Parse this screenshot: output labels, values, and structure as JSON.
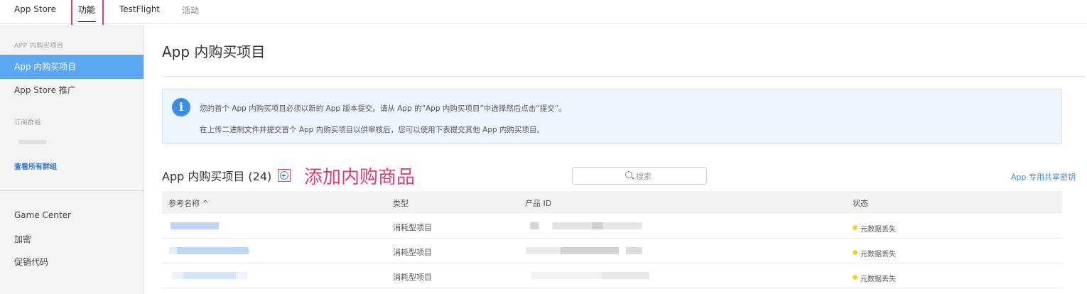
{
  "topnav": {
    "tabs": [
      {
        "label": "App Store"
      },
      {
        "label": "功能"
      },
      {
        "label": "TestFlight"
      },
      {
        "label": "活动"
      }
    ]
  },
  "sidebar": {
    "section1": "APP 内购买项目",
    "items": [
      {
        "label": "App 内购买项目",
        "active": true
      },
      {
        "label": "App Store 推广",
        "active": false
      }
    ],
    "section2": "订阅群组",
    "view_all": "查看所有群组",
    "bottom_items": [
      {
        "label": "Game Center"
      },
      {
        "label": "加密"
      },
      {
        "label": "促销代码"
      }
    ]
  },
  "main": {
    "title": "App 内购买项目",
    "info": {
      "line1": "您的首个 App 内购买项目必须以新的 App 版本提交。请从 App 的“App 内购买项目”中选择然后点击“提交”。",
      "line2": "在上传二进制文件并提交首个 App 内购买项目以供审核后，您可以使用下表提交其他 App 内购买项目。"
    },
    "list_heading": "App 内购买项目 (24)",
    "annotation": "添加内购商品",
    "search_placeholder": "搜索",
    "shared_secret_link": "App 专用共享密钥",
    "table": {
      "headers": [
        "参考名称 ^",
        "类型",
        "产品 ID",
        "状态"
      ],
      "rows": [
        {
          "type": "消耗型项目",
          "status": "元数据丢失"
        },
        {
          "type": "消耗型项目",
          "status": "元数据丢失"
        },
        {
          "type": "消耗型项目",
          "status": "元数据丢失"
        }
      ]
    }
  },
  "colors": {
    "accent": "#3a8ee6",
    "sidebar_active": "#5aa7f2",
    "annotation": "#e33a7a",
    "status_dot": "#f2d22e"
  },
  "icons": [
    "info-icon",
    "add-circle-icon",
    "search-icon",
    "status-dot-icon"
  ]
}
